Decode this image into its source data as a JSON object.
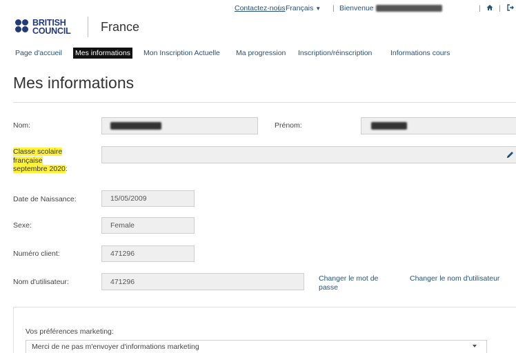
{
  "header": {
    "contact_label": "Contactez-nous",
    "language_label": "Français",
    "welcome_label": "Bienvenue",
    "country": "France",
    "logo_line1": "BRITISH",
    "logo_line2": "COUNCIL"
  },
  "nav": {
    "items": [
      "Page d'accueil",
      "Mes informations",
      "Mon Inscription Actuelle",
      "Ma progression",
      "Inscription/réinscription",
      "Informations cours"
    ],
    "active_index": 1
  },
  "page": {
    "title": "Mes informations"
  },
  "form": {
    "nom_label": "Nom:",
    "prenom_label": "Prénom:",
    "classe_line1": "Classe scolaire",
    "classe_line2": "française",
    "classe_line3": "septembre 2020",
    "classe_colon": ":",
    "dob_label": "Date de Naissance:",
    "dob_value": "15/05/2009",
    "sexe_label": "Sexe:",
    "sexe_value": "Female",
    "client_label": "Numéro client:",
    "client_value": "471296",
    "username_label": "Nom d'utilisateur:",
    "username_value": "471296",
    "change_password_line1": "Changer le mot de",
    "change_password_line2": "passe",
    "change_username": "Changer le nom d'utilisateur"
  },
  "marketing": {
    "label": "Vos préférences marketing:",
    "selected": "Merci de ne pas m'envoyer d'informations marketing"
  },
  "colors": {
    "brand": "#23397a",
    "link": "#23527c",
    "highlight": "#fff23a"
  }
}
